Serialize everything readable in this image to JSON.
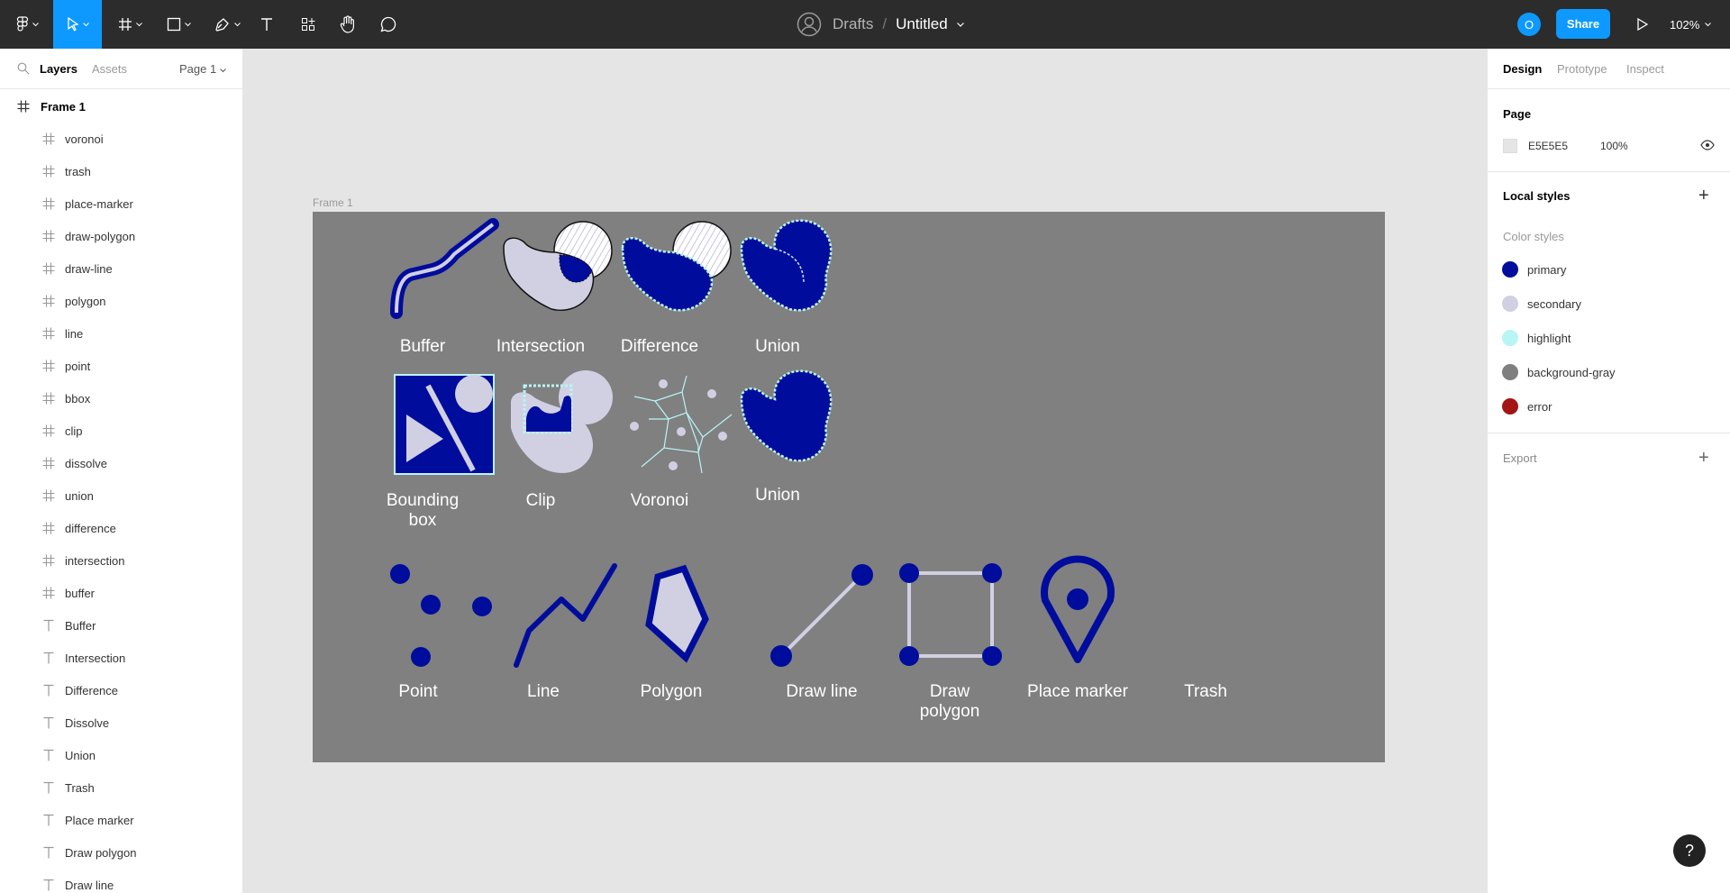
{
  "toolbar": {
    "project": "Drafts",
    "separator": "/",
    "file_name": "Untitled",
    "user_initial": "O",
    "share_label": "Share",
    "zoom": "102%"
  },
  "left_panel": {
    "tabs": {
      "layers": "Layers",
      "assets": "Assets",
      "page": "Page 1"
    },
    "frame_name": "Frame 1",
    "layers": [
      {
        "name": "voronoi",
        "type": "frame"
      },
      {
        "name": "trash",
        "type": "frame"
      },
      {
        "name": "place-marker",
        "type": "frame"
      },
      {
        "name": "draw-polygon",
        "type": "frame"
      },
      {
        "name": "draw-line",
        "type": "frame"
      },
      {
        "name": "polygon",
        "type": "frame"
      },
      {
        "name": "line",
        "type": "frame"
      },
      {
        "name": "point",
        "type": "frame"
      },
      {
        "name": "bbox",
        "type": "frame"
      },
      {
        "name": "clip",
        "type": "frame"
      },
      {
        "name": "dissolve",
        "type": "frame"
      },
      {
        "name": "union",
        "type": "frame"
      },
      {
        "name": "difference",
        "type": "frame"
      },
      {
        "name": "intersection",
        "type": "frame"
      },
      {
        "name": "buffer",
        "type": "frame"
      },
      {
        "name": "Buffer",
        "type": "text"
      },
      {
        "name": "Intersection",
        "type": "text"
      },
      {
        "name": "Difference",
        "type": "text"
      },
      {
        "name": "Dissolve",
        "type": "text"
      },
      {
        "name": "Union",
        "type": "text"
      },
      {
        "name": "Trash",
        "type": "text"
      },
      {
        "name": "Place marker",
        "type": "text"
      },
      {
        "name": "Draw polygon",
        "type": "text"
      },
      {
        "name": "Draw line",
        "type": "text"
      }
    ]
  },
  "right_panel": {
    "tabs": {
      "design": "Design",
      "prototype": "Prototype",
      "inspect": "Inspect"
    },
    "page_title": "Page",
    "page_color": "E5E5E5",
    "page_opacity": "100%",
    "local_styles_title": "Local styles",
    "color_styles_title": "Color styles",
    "color_styles": [
      {
        "name": "primary",
        "color": "#000c9c"
      },
      {
        "name": "secondary",
        "color": "#d0d0e2"
      },
      {
        "name": "highlight",
        "color": "#b8f5f5"
      },
      {
        "name": "background-gray",
        "color": "#7f7f7f"
      },
      {
        "name": "error",
        "color": "#a31515"
      }
    ],
    "export_title": "Export"
  },
  "canvas": {
    "frame_label": "Frame 1",
    "labels": {
      "buffer": "Buffer",
      "intersection": "Intersection",
      "difference": "Difference",
      "union_1": "Union",
      "bbox_line1": "Bounding",
      "bbox_line2": "box",
      "clip": "Clip",
      "voronoi": "Voronoi",
      "union_2": "Union",
      "point": "Point",
      "line": "Line",
      "polygon": "Polygon",
      "draw_line": "Draw line",
      "draw_polygon_line1": "Draw",
      "draw_polygon_line2": "polygon",
      "place_marker": "Place marker",
      "trash": "Trash"
    }
  },
  "help_label": "?"
}
